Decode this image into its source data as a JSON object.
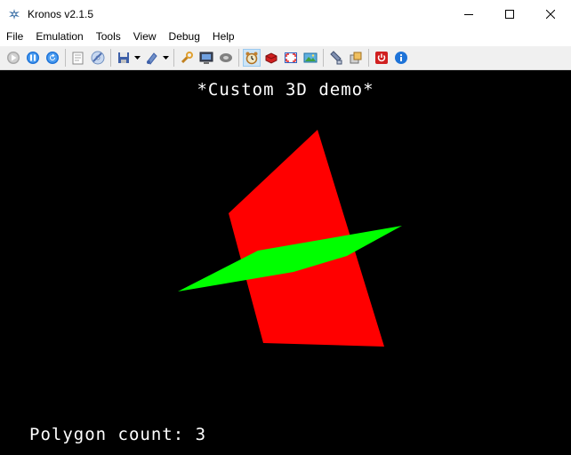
{
  "window": {
    "title": "Kronos v2.1.5"
  },
  "menu": {
    "items": [
      {
        "label": "File"
      },
      {
        "label": "Emulation"
      },
      {
        "label": "Tools"
      },
      {
        "label": "View"
      },
      {
        "label": "Debug"
      },
      {
        "label": "Help"
      }
    ]
  },
  "toolbar": {
    "buttons": [
      {
        "icon": "run-icon"
      },
      {
        "icon": "pause-icon"
      },
      {
        "icon": "reset-icon"
      },
      {
        "icon": "open-iso-icon"
      },
      {
        "icon": "open-cd-icon"
      },
      {
        "icon": "save-state-icon"
      },
      {
        "icon": "load-state-icon"
      },
      {
        "icon": "settings-wrench-icon"
      },
      {
        "icon": "monitor-icon"
      },
      {
        "icon": "cd-drive-icon"
      },
      {
        "icon": "alarm-clock-icon"
      },
      {
        "icon": "record-icon"
      },
      {
        "icon": "fullscreen-icon"
      },
      {
        "icon": "screenshot-icon"
      },
      {
        "icon": "cheats-icon"
      },
      {
        "icon": "transfer-icon"
      },
      {
        "icon": "power-icon"
      },
      {
        "icon": "about-icon"
      }
    ]
  },
  "screen": {
    "demo_title": "*Custom 3D demo*",
    "polygon_count": "Polygon count: 3",
    "colors": {
      "background": "#000000",
      "text": "#ffffff",
      "red_polygon": "#ff0000",
      "green_polygon": "#00ff00"
    }
  }
}
